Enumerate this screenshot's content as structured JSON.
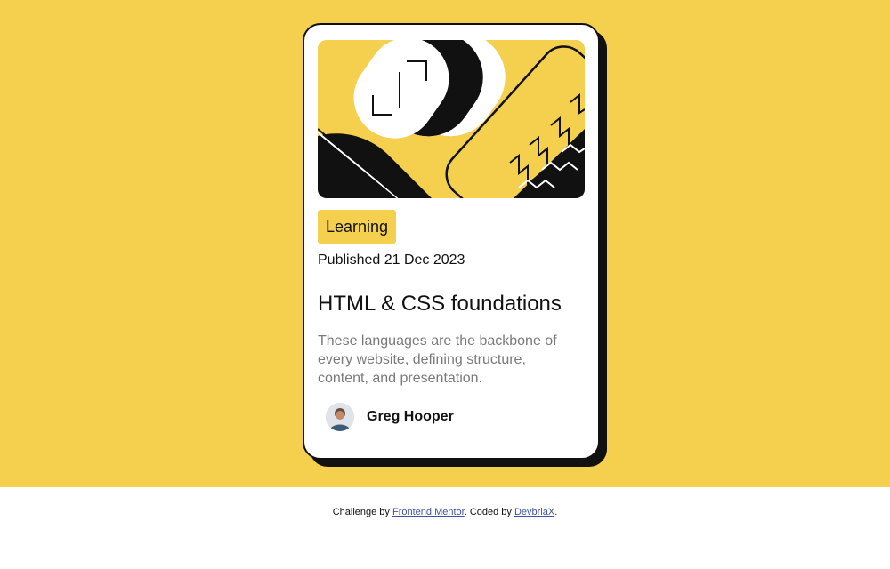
{
  "card": {
    "image_alt_icon": "abstract-illustration",
    "tag": "Learning",
    "published": "Published 21 Dec 2023",
    "title": "HTML & CSS foundations",
    "description": "These languages are the backbone of every website, defining structure, content, and presentation.",
    "author": {
      "name": "Greg Hooper",
      "avatar_icon": "avatar-photo"
    }
  },
  "footer": {
    "prefix": "Challenge by ",
    "link1": "Frontend Mentor",
    "middle": ". Coded by ",
    "link2": "DevbriaX",
    "suffix": "."
  },
  "colors": {
    "background_yellow": "#f4d04e",
    "card_bg": "#ffffff",
    "ink": "#111111",
    "muted_text": "#7a7a7a",
    "link": "#3e52a3"
  }
}
